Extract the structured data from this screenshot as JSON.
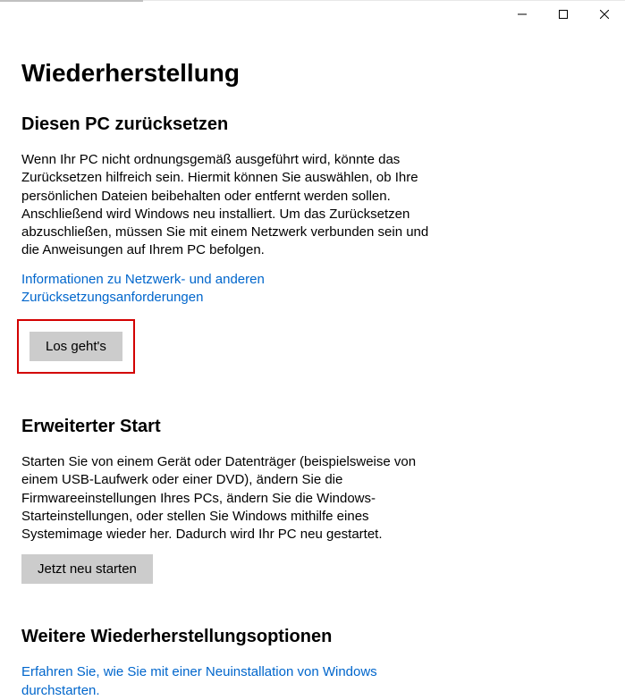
{
  "page": {
    "title": "Wiederherstellung"
  },
  "reset_section": {
    "heading": "Diesen PC zurücksetzen",
    "body": "Wenn Ihr PC nicht ordnungsgemäß ausgeführt wird, könnte das Zurücksetzen hilfreich sein. Hiermit können Sie auswählen, ob Ihre persönlichen Dateien beibehalten oder entfernt werden sollen. Anschließend wird Windows neu installiert. Um das Zurücksetzen abzuschließen, müssen Sie mit einem Netzwerk verbunden sein und die Anweisungen auf Ihrem PC befolgen.",
    "link": "Informationen zu Netzwerk- und anderen Zurücksetzungsanforderungen",
    "button": "Los geht's"
  },
  "advanced_section": {
    "heading": "Erweiterter Start",
    "body": "Starten Sie von einem Gerät oder Datenträger (beispielsweise von einem USB-Laufwerk oder einer DVD), ändern Sie die Firmwareeinstellungen Ihres PCs, ändern Sie die Windows-Starteinstellungen, oder stellen Sie Windows mithilfe eines Systemimage wieder her. Dadurch wird Ihr PC neu gestartet.",
    "button": "Jetzt neu starten"
  },
  "more_section": {
    "heading": "Weitere Wiederherstellungsoptionen",
    "link": "Erfahren Sie, wie Sie mit einer Neuinstallation von Windows durchstarten."
  }
}
